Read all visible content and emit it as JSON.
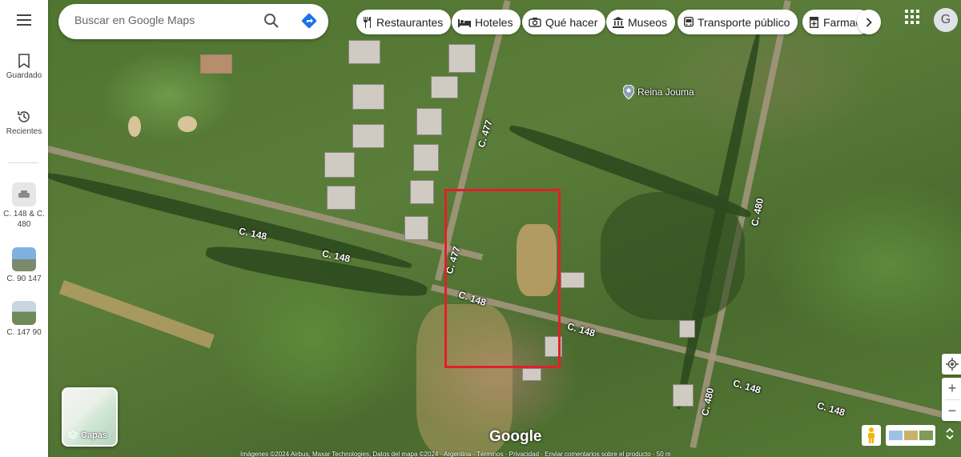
{
  "rail": {
    "saved_label": "Guardado",
    "recent_label": "Recientes",
    "recent_items": [
      {
        "label": "C. 148 & C. 480"
      },
      {
        "label": "C. 90 147"
      },
      {
        "label": "C. 147 90"
      }
    ]
  },
  "search": {
    "placeholder": "Buscar en Google Maps"
  },
  "chips": [
    {
      "label": "Restaurantes",
      "icon": "fork-knife-icon"
    },
    {
      "label": "Hoteles",
      "icon": "bed-icon"
    },
    {
      "label": "Qué hacer",
      "icon": "camera-icon"
    },
    {
      "label": "Museos",
      "icon": "museum-icon"
    },
    {
      "label": "Transporte público",
      "icon": "bus-icon"
    },
    {
      "label": "Farmac",
      "icon": "pharmacy-icon"
    }
  ],
  "account": {
    "initial": "G"
  },
  "map": {
    "labels": [
      {
        "text": "C. 477"
      },
      {
        "text": "C. 477"
      },
      {
        "text": "C. 148"
      },
      {
        "text": "C. 148"
      },
      {
        "text": "C. 148"
      },
      {
        "text": "C. 148"
      },
      {
        "text": "C. 148"
      },
      {
        "text": "C. 148"
      },
      {
        "text": "C. 480"
      },
      {
        "text": "C. 480"
      }
    ],
    "place": "Reina Jouma",
    "highlight_color": "#e0202a"
  },
  "layers": {
    "label": "Capas"
  },
  "zoom": {
    "in": "+",
    "out": "−"
  },
  "logo": "Google",
  "footer": "Imágenes ©2024 Airbus, Maxar Technologies, Datos del mapa ©2024  ·  Argentina  ·  Términos  ·  Privacidad  ·  Enviar comentarios sobre el producto  ·  50 m"
}
